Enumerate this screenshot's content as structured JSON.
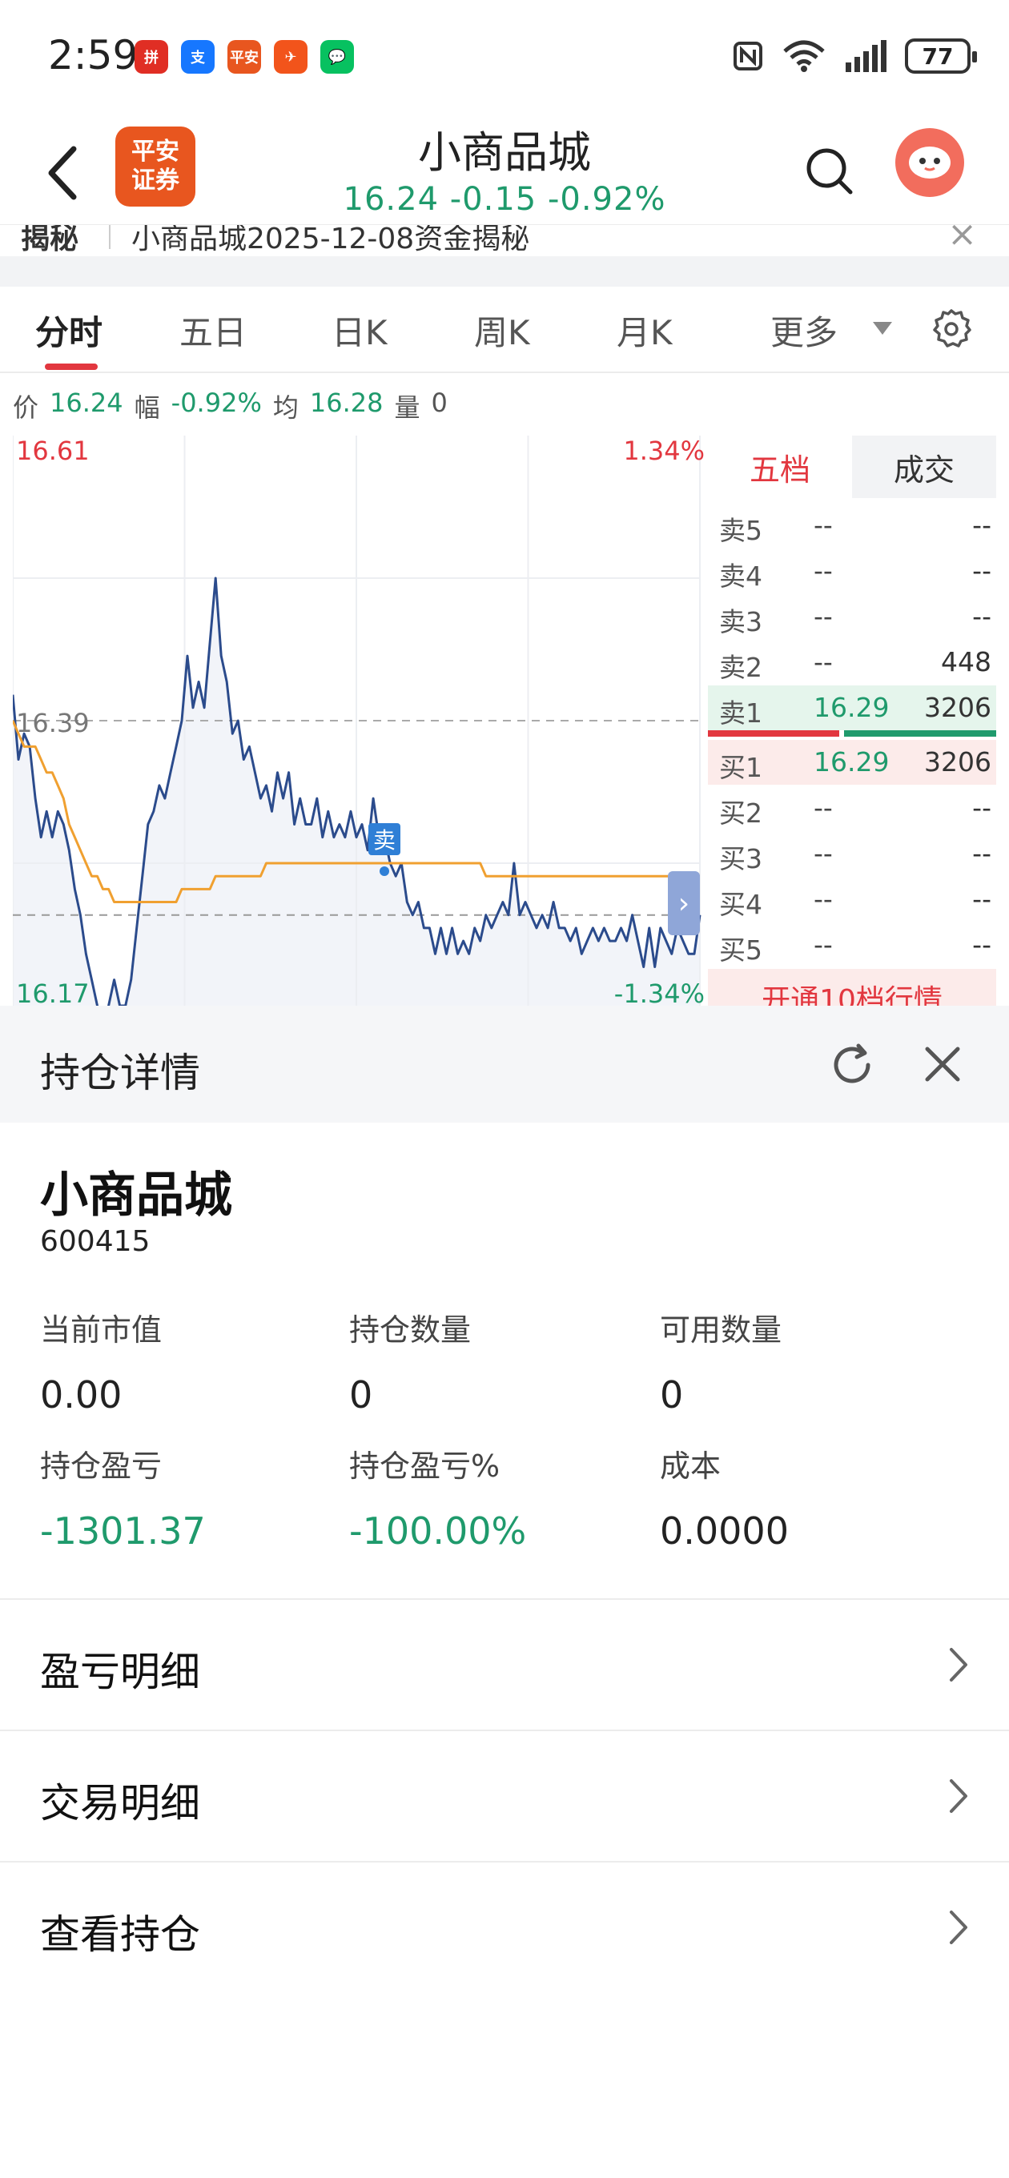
{
  "status_bar": {
    "time": "2:59",
    "battery": "77",
    "app_icons": [
      {
        "name": "pinduoduo-icon",
        "color": "#e02e24",
        "text": "拼"
      },
      {
        "name": "alipay-icon",
        "color": "#1677ff",
        "text": "支"
      },
      {
        "name": "pingan-securities-icon",
        "color": "#e8561f",
        "text": "平安"
      },
      {
        "name": "feishu-icon",
        "color": "#f2541b",
        "text": "✈"
      },
      {
        "name": "wechat-icon",
        "color": "#07c160",
        "text": "💬"
      }
    ]
  },
  "header": {
    "logo_line1": "平安",
    "logo_line2": "证券",
    "title": "小商品城",
    "quote": "16.24 -0.15 -0.92%"
  },
  "news": {
    "tag": "揭秘",
    "text": "小商品城2025-12-08资金揭秘",
    "close": "×"
  },
  "tabs": [
    {
      "label": "分时",
      "active": true
    },
    {
      "label": "五日",
      "active": false
    },
    {
      "label": "日K",
      "active": false
    },
    {
      "label": "周K",
      "active": false
    },
    {
      "label": "月K",
      "active": false
    },
    {
      "label": "更多",
      "active": false
    }
  ],
  "quote_line": {
    "price_label": "价",
    "price": "16.24",
    "range_label": "幅",
    "range": "-0.92%",
    "avg_label": "均",
    "avg": "16.28",
    "vol_label": "量",
    "vol": "0"
  },
  "chart_data": {
    "type": "line",
    "title": "",
    "y_top_label": "16.61",
    "y_mid_label": "16.39",
    "y_bottom_label": "16.17",
    "pct_top_label": "1.34%",
    "pct_bottom_label": "-1.34%",
    "ylim": [
      16.17,
      16.61
    ],
    "prev_close": 16.39,
    "grid": true,
    "sell_marker": "卖",
    "series": [
      {
        "color": "#2b4b8c",
        "values": [
          16.41,
          16.36,
          16.38,
          16.37,
          16.33,
          16.3,
          16.32,
          16.3,
          16.32,
          16.31,
          16.29,
          16.26,
          16.24,
          16.21,
          16.19,
          16.17,
          16.14,
          16.17,
          16.19,
          16.17,
          16.17,
          16.19,
          16.23,
          16.27,
          16.31,
          16.32,
          16.34,
          16.33,
          16.35,
          16.37,
          16.39,
          16.44,
          16.4,
          16.42,
          16.4,
          16.45,
          16.5,
          16.44,
          16.42,
          16.38,
          16.39,
          16.36,
          16.37,
          16.35,
          16.33,
          16.34,
          16.32,
          16.35,
          16.33,
          16.35,
          16.31,
          16.33,
          16.31,
          16.31,
          16.33,
          16.3,
          16.32,
          16.3,
          16.31,
          16.3,
          16.32,
          16.3,
          16.31,
          16.29,
          16.33,
          16.3,
          16.3,
          16.28,
          16.27,
          16.28,
          16.25,
          16.24,
          16.25,
          16.23,
          16.23,
          16.21,
          16.23,
          16.21,
          16.23,
          16.21,
          16.22,
          16.21,
          16.23,
          16.22,
          16.24,
          16.23,
          16.24,
          16.25,
          16.24,
          16.28,
          16.24,
          16.25,
          16.24,
          16.23,
          16.24,
          16.23,
          16.25,
          16.23,
          16.23,
          16.22,
          16.23,
          16.21,
          16.22,
          16.23,
          16.22,
          16.23,
          16.22,
          16.22,
          16.23,
          16.22,
          16.24,
          16.22,
          16.2,
          16.23,
          16.2,
          16.23,
          16.22,
          16.21,
          16.23,
          16.22,
          16.21,
          16.21,
          16.24
        ]
      },
      {
        "color": "#f0a030",
        "values": [
          16.39,
          16.38,
          16.37,
          16.37,
          16.37,
          16.36,
          16.35,
          16.35,
          16.34,
          16.33,
          16.31,
          16.3,
          16.29,
          16.28,
          16.27,
          16.27,
          16.26,
          16.26,
          16.25,
          16.25,
          16.25,
          16.25,
          16.25,
          16.25,
          16.25,
          16.25,
          16.25,
          16.25,
          16.25,
          16.25,
          16.26,
          16.26,
          16.26,
          16.26,
          16.26,
          16.26,
          16.27,
          16.27,
          16.27,
          16.27,
          16.27,
          16.27,
          16.27,
          16.27,
          16.27,
          16.28,
          16.28,
          16.28,
          16.28,
          16.28,
          16.28,
          16.28,
          16.28,
          16.28,
          16.28,
          16.28,
          16.28,
          16.28,
          16.28,
          16.28,
          16.28,
          16.28,
          16.28,
          16.28,
          16.28,
          16.28,
          16.28,
          16.28,
          16.28,
          16.28,
          16.28,
          16.28,
          16.28,
          16.28,
          16.28,
          16.28,
          16.28,
          16.28,
          16.28,
          16.28,
          16.28,
          16.28,
          16.28,
          16.28,
          16.27,
          16.27,
          16.27,
          16.27,
          16.27,
          16.27,
          16.27,
          16.27,
          16.27,
          16.27,
          16.27,
          16.27,
          16.27,
          16.27,
          16.27,
          16.27,
          16.27,
          16.27,
          16.27,
          16.27,
          16.27,
          16.27,
          16.27,
          16.27,
          16.27,
          16.27,
          16.27,
          16.27,
          16.27,
          16.27,
          16.27,
          16.27,
          16.27,
          16.27,
          16.27,
          16.27,
          16.27,
          16.27,
          16.27
        ]
      }
    ]
  },
  "orderbook": {
    "tabs": [
      "五档",
      "成交"
    ],
    "sell": [
      {
        "label": "卖5",
        "price": "--",
        "vol": "--"
      },
      {
        "label": "卖4",
        "price": "--",
        "vol": "--"
      },
      {
        "label": "卖3",
        "price": "--",
        "vol": "--"
      },
      {
        "label": "卖2",
        "price": "--",
        "vol": "448"
      },
      {
        "label": "卖1",
        "price": "16.29",
        "vol": "3206"
      }
    ],
    "buy": [
      {
        "label": "买1",
        "price": "16.29",
        "vol": "3206"
      },
      {
        "label": "买2",
        "price": "--",
        "vol": "--"
      },
      {
        "label": "买3",
        "price": "--",
        "vol": "--"
      },
      {
        "label": "买4",
        "price": "--",
        "vol": "--"
      },
      {
        "label": "买5",
        "price": "--",
        "vol": "--"
      }
    ],
    "upgrade": "开通10档行情"
  },
  "holding": {
    "title": "持仓详情",
    "stock_name": "小商品城",
    "stock_code": "600415",
    "stats": [
      {
        "label": "当前市值",
        "value": "0.00",
        "green": false
      },
      {
        "label": "持仓数量",
        "value": "0",
        "green": false
      },
      {
        "label": "可用数量",
        "value": "0",
        "green": false
      },
      {
        "label": "持仓盈亏",
        "value": "-1301.37",
        "green": true
      },
      {
        "label": "持仓盈亏%",
        "value": "-100.00%",
        "green": true
      },
      {
        "label": "成本",
        "value": "0.0000",
        "green": false
      }
    ],
    "menu": [
      "盈亏明细",
      "交易明细",
      "查看持仓"
    ]
  }
}
